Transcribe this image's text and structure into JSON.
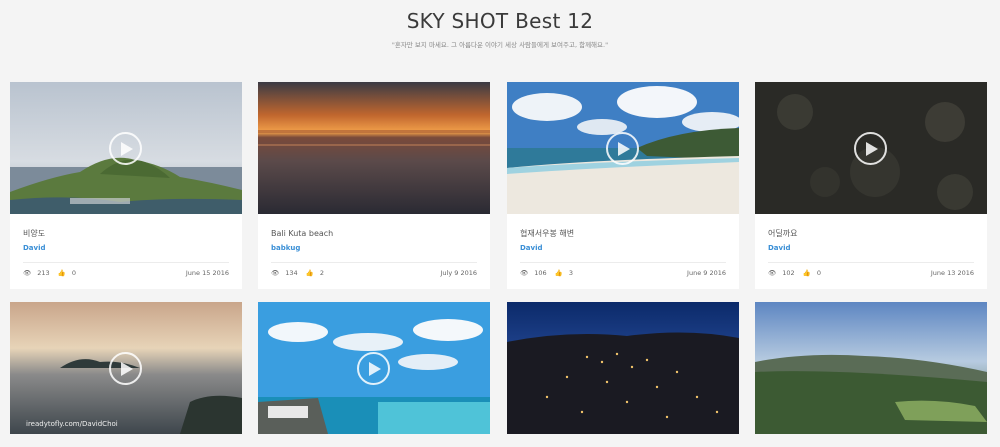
{
  "page": {
    "title": "SKY SHOT Best 12",
    "subtitle": "\"혼자만 보지 마세요. 그 아름다운 이야기 세상 사람들에게 보여주고, 함께해요.\""
  },
  "icons": {
    "views": "eye-icon",
    "likes": "thumbs-up-icon",
    "play": "play-icon"
  },
  "cards": [
    {
      "title": "비양도",
      "author": "David",
      "views": "213",
      "likes": "0",
      "date": "June 15 2016",
      "has_play": true
    },
    {
      "title": "Bali Kuta beach",
      "author": "babkug",
      "views": "134",
      "likes": "2",
      "date": "July 9 2016",
      "has_play": false
    },
    {
      "title": "협재서우봉 해변",
      "author": "David",
      "views": "106",
      "likes": "3",
      "date": "June 9 2016",
      "has_play": true
    },
    {
      "title": "어딜까요",
      "author": "David",
      "views": "102",
      "likes": "0",
      "date": "June 13 2016",
      "has_play": true
    },
    {
      "title": "",
      "author": "",
      "views": "",
      "likes": "",
      "date": "",
      "has_play": true,
      "watermark": "ireadytofly.com/DavidChoi"
    },
    {
      "title": "",
      "author": "",
      "views": "",
      "likes": "",
      "date": "",
      "has_play": true
    },
    {
      "title": "",
      "author": "",
      "views": "",
      "likes": "",
      "date": "",
      "has_play": false
    },
    {
      "title": "",
      "author": "",
      "views": "",
      "likes": "",
      "date": "",
      "has_play": false
    }
  ]
}
